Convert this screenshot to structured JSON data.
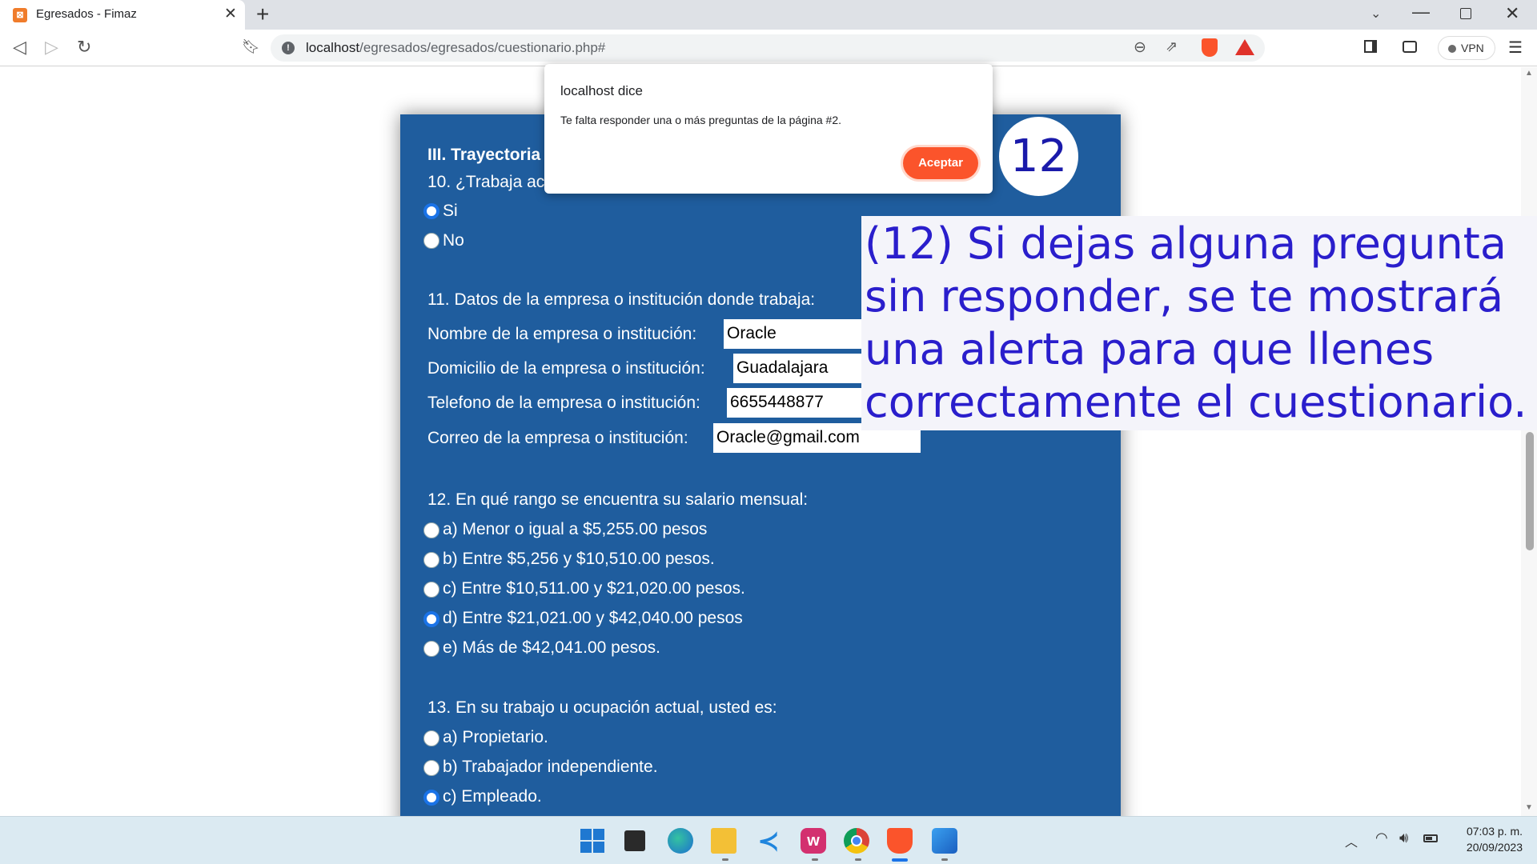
{
  "browser": {
    "tab_title": "Egresados - Fimaz",
    "tab_favicon": "xampp-icon",
    "new_tab": "+",
    "close_glyph": "✕",
    "url_host": "localhost",
    "url_path": "/egresados/egresados/cuestionario.php#",
    "vpn_label": "VPN"
  },
  "form": {
    "section_title": "III. Trayectoria",
    "q10": {
      "label": "10. ¿Trabaja ac",
      "options": [
        {
          "label": "Si",
          "checked": true
        },
        {
          "label": "No",
          "checked": false
        }
      ]
    },
    "q11": {
      "label": "11. Datos de la empresa o institución donde trabaja:",
      "fields": [
        {
          "label": "Nombre de la empresa o institución:",
          "value": "Oracle"
        },
        {
          "label": "Domicilio de la empresa o institución:",
          "value": "Guadalajara"
        },
        {
          "label": "Telefono de la empresa o institución:",
          "value": "6655448877"
        },
        {
          "label": "Correo de la empresa o institución:",
          "value": "Oracle@gmail.com"
        }
      ]
    },
    "q12": {
      "label": "12. En qué rango se encuentra su salario mensual:",
      "options": [
        {
          "label": "a) Menor o igual a $5,255.00 pesos",
          "checked": false
        },
        {
          "label": "b) Entre $5,256 y $10,510.00 pesos.",
          "checked": false
        },
        {
          "label": "c) Entre $10,511.00 y $21,020.00 pesos.",
          "checked": false
        },
        {
          "label": "d) Entre $21,021.00 y $42,040.00 pesos",
          "checked": true
        },
        {
          "label": "e) Más de $42,041.00 pesos.",
          "checked": false
        }
      ]
    },
    "q13": {
      "label": "13. En su trabajo u ocupación actual, usted es:",
      "options": [
        {
          "label": "a) Propietario.",
          "checked": false
        },
        {
          "label": "b) Trabajador independiente.",
          "checked": false
        },
        {
          "label": "c) Empleado.",
          "checked": true
        }
      ]
    }
  },
  "alert": {
    "title": "localhost dice",
    "message": "Te falta responder una o más preguntas de la página #2.",
    "ok_label": "Aceptar"
  },
  "overlay": {
    "step_number": "12",
    "note": "(12) Si dejas alguna pregunta sin responder, se te mostrará una alerta para que llenes correctamente el cuestionario."
  },
  "taskbar": {
    "time": "07:03 p. m.",
    "date": "20/09/2023"
  },
  "colors": {
    "form_bg": "#1f5d9e",
    "accent": "#fb542b",
    "overlay_text": "#2a1ecc"
  }
}
